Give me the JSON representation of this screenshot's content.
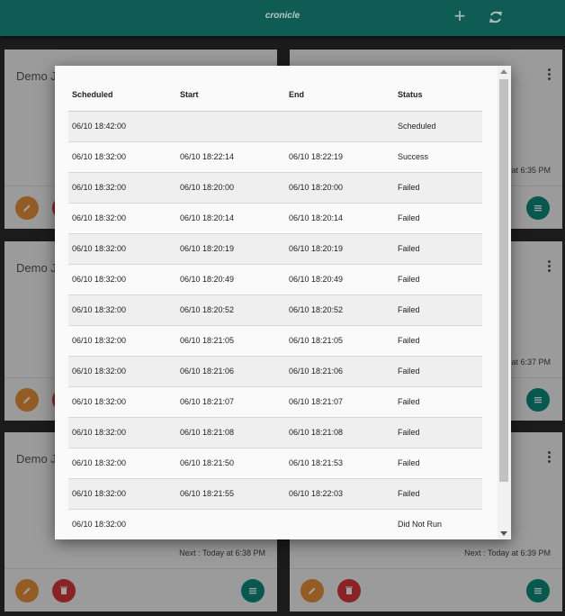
{
  "app": {
    "title": "cronicle",
    "add_label": "+",
    "add_icon": "plus-icon",
    "refresh_icon": "refresh-icon"
  },
  "cards": [
    {
      "title": "Demo J",
      "next": ""
    },
    {
      "title": "",
      "next": "at 6:35 PM"
    },
    {
      "title": "Demo J",
      "next": ""
    },
    {
      "title": "",
      "next": "at 6:37 PM"
    },
    {
      "title": "Demo J",
      "next": "Next : Today at 6:38 PM"
    },
    {
      "title": "",
      "next": "Next : Today at 6:39 PM"
    }
  ],
  "history": {
    "headers": [
      "Scheduled",
      "Start",
      "End",
      "Status"
    ],
    "rows": [
      [
        "06/10 18:42:00",
        "",
        "",
        "Scheduled"
      ],
      [
        "06/10 18:32:00",
        "06/10 18:22:14",
        "06/10 18:22:19",
        "Success"
      ],
      [
        "06/10 18:32:00",
        "06/10 18:20:00",
        "06/10 18:20:00",
        "Failed"
      ],
      [
        "06/10 18:32:00",
        "06/10 18:20:14",
        "06/10 18:20:14",
        "Failed"
      ],
      [
        "06/10 18:32:00",
        "06/10 18:20:19",
        "06/10 18:20:19",
        "Failed"
      ],
      [
        "06/10 18:32:00",
        "06/10 18:20:49",
        "06/10 18:20:49",
        "Failed"
      ],
      [
        "06/10 18:32:00",
        "06/10 18:20:52",
        "06/10 18:20:52",
        "Failed"
      ],
      [
        "06/10 18:32:00",
        "06/10 18:21:05",
        "06/10 18:21:05",
        "Failed"
      ],
      [
        "06/10 18:32:00",
        "06/10 18:21:06",
        "06/10 18:21:06",
        "Failed"
      ],
      [
        "06/10 18:32:00",
        "06/10 18:21:07",
        "06/10 18:21:07",
        "Failed"
      ],
      [
        "06/10 18:32:00",
        "06/10 18:21:08",
        "06/10 18:21:08",
        "Failed"
      ],
      [
        "06/10 18:32:00",
        "06/10 18:21:50",
        "06/10 18:21:53",
        "Failed"
      ],
      [
        "06/10 18:32:00",
        "06/10 18:21:55",
        "06/10 18:22:03",
        "Failed"
      ],
      [
        "06/10 18:32:00",
        "",
        "",
        "Did Not Run"
      ]
    ]
  },
  "colors": {
    "appbar": "#0f5c54",
    "edit": "#e8903a",
    "delete": "#d8383a",
    "list": "#0b8b7d"
  }
}
